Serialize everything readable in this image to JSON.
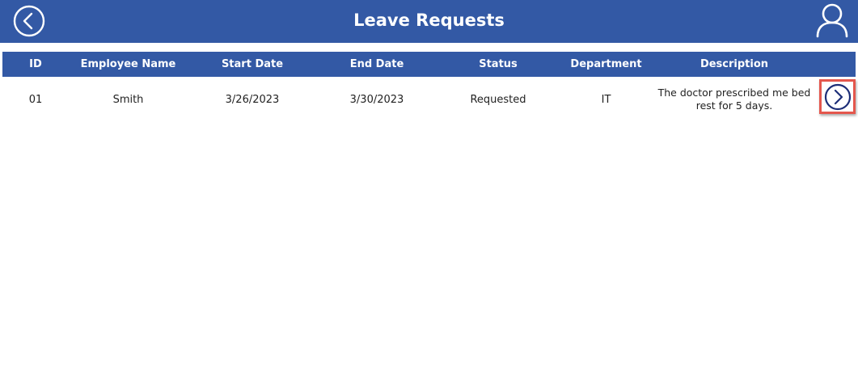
{
  "header": {
    "title": "Leave Requests",
    "back_icon": "chevron-left-circle-icon",
    "user_icon": "user-icon",
    "color": "#3359a5"
  },
  "table": {
    "columns": [
      "ID",
      "Employee Name",
      "Start Date",
      "End Date",
      "Status",
      "Department",
      "Description"
    ],
    "rows": [
      {
        "id": "01",
        "employee_name": "Smith",
        "start_date": "3/26/2023",
        "end_date": "3/30/2023",
        "status": "Requested",
        "department": "IT",
        "description": "The doctor prescribed me bed rest for 5 days.",
        "action_icon": "chevron-right-circle-icon"
      }
    ]
  },
  "colors": {
    "header_bg": "#3359a5",
    "highlight_border": "#e4574d",
    "action_icon": "#1e2f78"
  }
}
